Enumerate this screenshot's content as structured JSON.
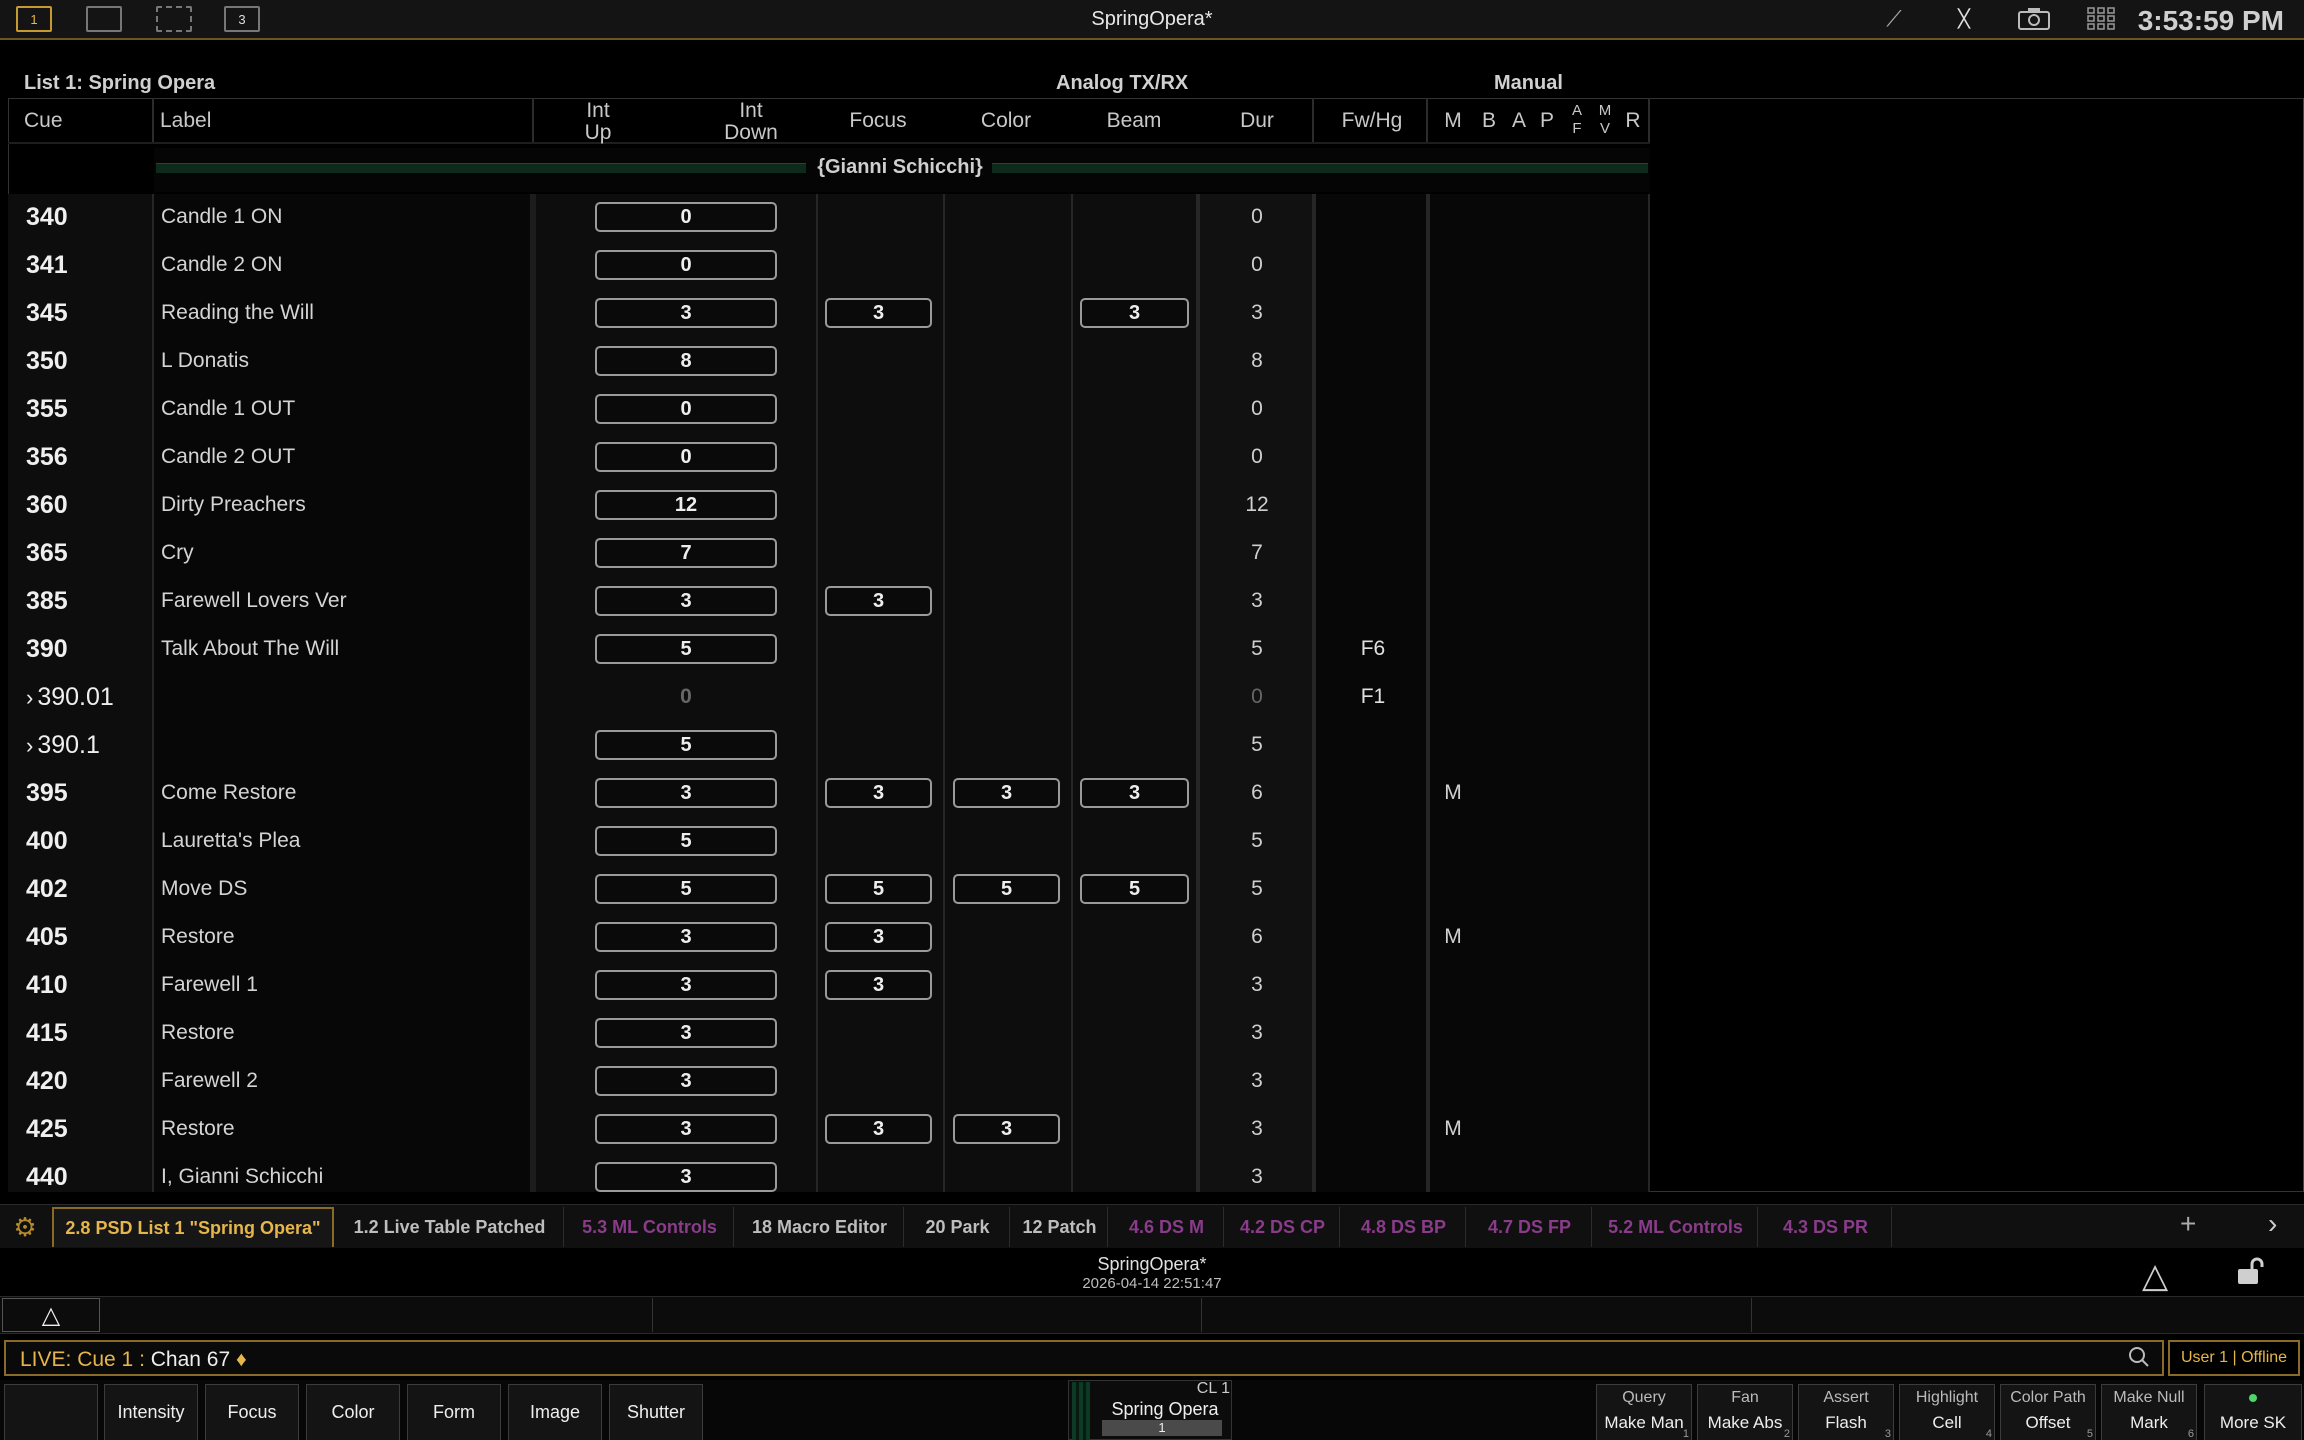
{
  "topbar": {
    "ws1": "1",
    "ws3": "3",
    "title": "SpringOpera*",
    "clock": "3:53:59 PM"
  },
  "list": {
    "title": "List 1: Spring Opera",
    "group1": "Analog TX/RX",
    "group2": "Manual"
  },
  "columns": {
    "cue": "Cue",
    "label": "Label",
    "int_up_1": "Int",
    "int_up_2": "Up",
    "int_down_1": "Int",
    "int_down_2": "Down",
    "focus": "Focus",
    "color": "Color",
    "beam": "Beam",
    "dur": "Dur",
    "fwhg": "Fw/Hg",
    "m": "M",
    "b": "B",
    "a": "A",
    "p": "P",
    "af_1": "A",
    "af_2": "F",
    "mv_1": "M",
    "mv_2": "V",
    "r": "R"
  },
  "scene": "{Gianni Schicchi}",
  "cues": [
    {
      "cue": "340",
      "label": "Candle 1 ON",
      "up": "0",
      "focus": "",
      "color": "",
      "beam": "",
      "dur": "0",
      "fw": "",
      "flag": ""
    },
    {
      "cue": "341",
      "label": "Candle 2 ON",
      "up": "0",
      "focus": "",
      "color": "",
      "beam": "",
      "dur": "0",
      "fw": "",
      "flag": ""
    },
    {
      "cue": "345",
      "label": "Reading the Will",
      "up": "3",
      "focus": "3",
      "color": "",
      "beam": "3",
      "dur": "3",
      "fw": "",
      "flag": ""
    },
    {
      "cue": "350",
      "label": "L Donatis",
      "up": "8",
      "focus": "",
      "color": "",
      "beam": "",
      "dur": "8",
      "fw": "",
      "flag": ""
    },
    {
      "cue": "355",
      "label": "Candle 1 OUT",
      "up": "0",
      "focus": "",
      "color": "",
      "beam": "",
      "dur": "0",
      "fw": "",
      "flag": ""
    },
    {
      "cue": "356",
      "label": "Candle 2 OUT",
      "up": "0",
      "focus": "",
      "color": "",
      "beam": "",
      "dur": "0",
      "fw": "",
      "flag": ""
    },
    {
      "cue": "360",
      "label": "Dirty Preachers",
      "up": "12",
      "focus": "",
      "color": "",
      "beam": "",
      "dur": "12",
      "fw": "",
      "flag": ""
    },
    {
      "cue": "365",
      "label": "Cry",
      "up": "7",
      "focus": "",
      "color": "",
      "beam": "",
      "dur": "7",
      "fw": "",
      "flag": ""
    },
    {
      "cue": "385",
      "label": "Farewell Lovers Ver",
      "up": "3",
      "focus": "3",
      "color": "",
      "beam": "",
      "dur": "3",
      "fw": "",
      "flag": ""
    },
    {
      "cue": "390",
      "label": "Talk About The Will",
      "up": "5",
      "focus": "",
      "color": "",
      "beam": "",
      "dur": "5",
      "fw": "F6",
      "flag": ""
    },
    {
      "cue": "390.01",
      "part": true,
      "label": "",
      "up": "0",
      "ghost": true,
      "focus": "",
      "color": "",
      "beam": "",
      "dur": "0",
      "fw": "F1",
      "flag": ""
    },
    {
      "cue": "390.1",
      "part": true,
      "label": "",
      "up": "5",
      "focus": "",
      "color": "",
      "beam": "",
      "dur": "5",
      "fw": "",
      "flag": ""
    },
    {
      "cue": "395",
      "label": "Come Restore",
      "up": "3",
      "focus": "3",
      "color": "3",
      "beam": "3",
      "dur": "6",
      "fw": "",
      "flag": "M"
    },
    {
      "cue": "400",
      "label": "Lauretta's Plea",
      "up": "5",
      "focus": "",
      "color": "",
      "beam": "",
      "dur": "5",
      "fw": "",
      "flag": ""
    },
    {
      "cue": "402",
      "label": "Move DS",
      "up": "5",
      "focus": "5",
      "color": "5",
      "beam": "5",
      "dur": "5",
      "fw": "",
      "flag": ""
    },
    {
      "cue": "405",
      "label": "Restore",
      "up": "3",
      "focus": "3",
      "color": "",
      "beam": "",
      "dur": "6",
      "fw": "",
      "flag": "M"
    },
    {
      "cue": "410",
      "label": "Farewell 1",
      "up": "3",
      "focus": "3",
      "color": "",
      "beam": "",
      "dur": "3",
      "fw": "",
      "flag": ""
    },
    {
      "cue": "415",
      "label": "Restore",
      "up": "3",
      "focus": "",
      "color": "",
      "beam": "",
      "dur": "3",
      "fw": "",
      "flag": ""
    },
    {
      "cue": "420",
      "label": "Farewell 2",
      "up": "3",
      "focus": "",
      "color": "",
      "beam": "",
      "dur": "3",
      "fw": "",
      "flag": ""
    },
    {
      "cue": "425",
      "label": "Restore",
      "up": "3",
      "focus": "3",
      "color": "3",
      "beam": "",
      "dur": "3",
      "fw": "",
      "flag": "M"
    },
    {
      "cue": "440",
      "label": "I, Gianni Schicchi",
      "up": "3",
      "focus": "",
      "color": "",
      "beam": "",
      "dur": "3",
      "fw": "",
      "flag": ""
    }
  ],
  "tabs": [
    {
      "label": "2.8 PSD List 1 \"Spring Opera\"",
      "style": "active"
    },
    {
      "label": "1.2 Live Table Patched",
      "style": "normal"
    },
    {
      "label": "5.3 ML Controls",
      "style": "purple"
    },
    {
      "label": "18 Macro Editor",
      "style": "normal"
    },
    {
      "label": "20 Park",
      "style": "normal"
    },
    {
      "label": "12 Patch",
      "style": "normal"
    },
    {
      "label": "4.6 DS  M",
      "style": "purple"
    },
    {
      "label": "4.2 DS  CP",
      "style": "purple"
    },
    {
      "label": "4.8 DS  BP",
      "style": "purple"
    },
    {
      "label": "4.7 DS  FP",
      "style": "purple"
    },
    {
      "label": "5.2 ML Controls",
      "style": "purple"
    },
    {
      "label": "4.3 DS  PR",
      "style": "purple"
    }
  ],
  "tab_plus": "+",
  "show": {
    "name": "SpringOpera*",
    "date": "2026-04-14 22:51:47"
  },
  "cmd": {
    "prefix": "LIVE: Cue  1 : ",
    "text": "Chan 67",
    "cursor": "♦",
    "user": "User 1 | Offline"
  },
  "softkeys": [
    "Intensity",
    "Focus",
    "Color",
    "Form",
    "Image",
    "Shutter"
  ],
  "cuelist_display": {
    "top": "CL 1",
    "name": "Spring Opera",
    "num": "1"
  },
  "rightkeys": [
    {
      "top": "Query",
      "bottom": "Make Man",
      "n": "1"
    },
    {
      "top": "Fan",
      "bottom": "Make Abs",
      "n": "2"
    },
    {
      "top": "Assert",
      "bottom": "Flash",
      "n": "3"
    },
    {
      "top": "Highlight",
      "bottom": "Cell",
      "n": "4"
    },
    {
      "top": "Color Path",
      "bottom": "Offset",
      "n": "5"
    },
    {
      "top": "Make Null",
      "bottom": "Mark",
      "n": "6"
    }
  ],
  "more_sk": "More SK",
  "colors": {
    "accent": "#e6b54b",
    "purple_tab": "#8a3c8a",
    "scene_bar": "#0e2a1c"
  }
}
